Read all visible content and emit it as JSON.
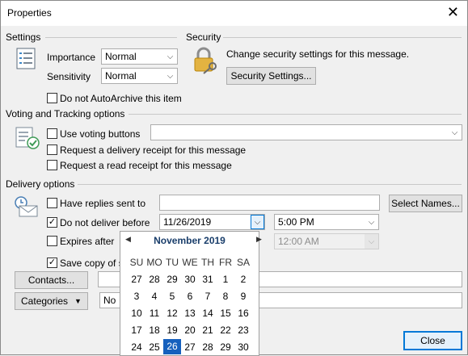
{
  "window": {
    "title": "Properties"
  },
  "settings": {
    "title": "Settings",
    "importance_label": "Importance",
    "importance_value": "Normal",
    "sensitivity_label": "Sensitivity",
    "sensitivity_value": "Normal",
    "autoarchive_label": "Do not AutoArchive this item"
  },
  "security": {
    "title": "Security",
    "text": "Change security settings for this message.",
    "button_label": "Security Settings..."
  },
  "voting": {
    "title": "Voting and Tracking options",
    "use_voting_label": "Use voting buttons",
    "voting_value": "",
    "delivery_receipt_label": "Request a delivery receipt for this message",
    "read_receipt_label": "Request a read receipt for this message"
  },
  "delivery": {
    "title": "Delivery options",
    "replies_label": "Have replies sent to",
    "replies_value": "",
    "select_names_label": "Select Names...",
    "do_not_deliver_label": "Do not deliver before",
    "do_not_deliver_checked": "✓",
    "deliver_date": "11/26/2019",
    "deliver_time": "5:00 PM",
    "expires_label": "Expires after",
    "expires_time": "12:00 AM",
    "save_copy_label": "Save copy of se",
    "save_copy_checked": "✓",
    "contacts_label": "Contacts...",
    "contacts_value": "",
    "categories_label": "Categories",
    "categories_value": "No"
  },
  "calendar": {
    "month_label": "November 2019",
    "prev": "◀",
    "next": "▶",
    "weekdays": [
      "SU",
      "MO",
      "TU",
      "WE",
      "TH",
      "FR",
      "SA"
    ],
    "weeks": [
      [
        "27",
        "28",
        "29",
        "30",
        "31",
        "1",
        "2"
      ],
      [
        "3",
        "4",
        "5",
        "6",
        "7",
        "8",
        "9"
      ],
      [
        "10",
        "11",
        "12",
        "13",
        "14",
        "15",
        "16"
      ],
      [
        "17",
        "18",
        "19",
        "20",
        "21",
        "22",
        "23"
      ],
      [
        "24",
        "25",
        "26",
        "27",
        "28",
        "29",
        "30"
      ]
    ],
    "selected_day": "26"
  },
  "footer": {
    "close_label": "Close"
  }
}
